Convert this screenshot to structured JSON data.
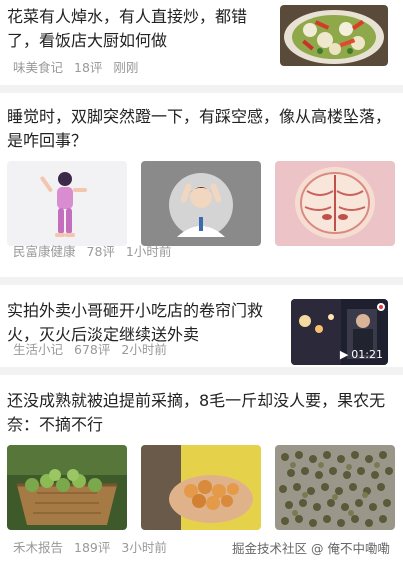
{
  "feed": [
    {
      "title": "花菜有人焯水，有人直接炒，都错了，看饭店大厨如何做",
      "source": "味美食记",
      "comments": "18评",
      "time": "刚刚",
      "thumbnail_icon": "cauliflower-dish-photo"
    },
    {
      "title": "睡觉时，双脚突然蹬一下，有踩空感，像从高楼坠落，是咋回事？",
      "source": "民富康健康",
      "comments": "78评",
      "time": "1小时前",
      "images": [
        "woman-stretching-illustration",
        "doctor-holding-head-illustration",
        "brain-cross-section-illustration"
      ]
    },
    {
      "title": "实拍外卖小哥砸开小吃店的卷帘门救火，灭火后淡定继续送外卖",
      "source": "生活小记",
      "comments": "678评",
      "time": "2小时前",
      "video_duration": "01:21",
      "thumbnail_icon": "night-fire-video-thumbnail"
    },
    {
      "title": "还没成熟就被迫提前采摘，8毛一斤却没人要，果农无奈：不摘不行",
      "source": "禾木报告",
      "comments": "189评",
      "time": "3小时前",
      "images": [
        "fruit-basket-photo",
        "hand-holding-fruit-photo",
        "dried-fruit-pile-photo"
      ]
    }
  ],
  "watermark": "掘金技术社区 @ 俺不中嘞嘞"
}
